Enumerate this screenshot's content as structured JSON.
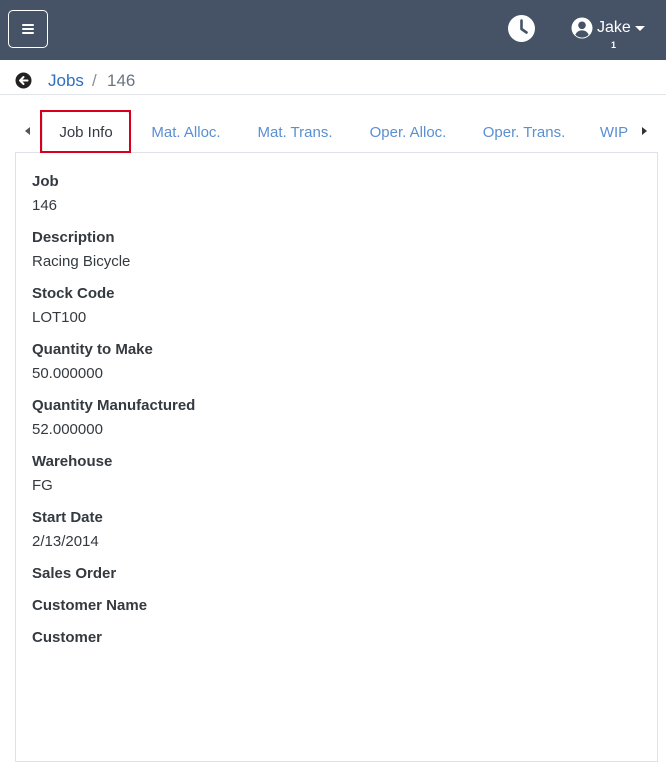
{
  "header": {
    "menu_icon": "hamburger-icon",
    "clock_icon": "clock-icon",
    "user": {
      "name": "Jake",
      "badge": "1",
      "icon": "user-circle-icon"
    },
    "bg_color": "#465366"
  },
  "breadcrumb": {
    "back_icon": "arrow-left-circle-icon",
    "parent": "Jobs",
    "separator": "/",
    "current": "146"
  },
  "tabs": [
    {
      "label": "Job Info",
      "active": true
    },
    {
      "label": "Mat. Alloc.",
      "active": false
    },
    {
      "label": "Mat. Trans.",
      "active": false
    },
    {
      "label": "Oper. Alloc.",
      "active": false
    },
    {
      "label": "Oper. Trans.",
      "active": false
    },
    {
      "label": "WIP",
      "active": false
    }
  ],
  "fields": [
    {
      "label": "Job",
      "value": "146"
    },
    {
      "label": "Description",
      "value": "Racing Bicycle"
    },
    {
      "label": "Stock Code",
      "value": "LOT100"
    },
    {
      "label": "Quantity to Make",
      "value": "50.000000"
    },
    {
      "label": "Quantity Manufactured",
      "value": "52.000000"
    },
    {
      "label": "Warehouse",
      "value": "FG"
    },
    {
      "label": "Start Date",
      "value": "2/13/2014"
    },
    {
      "label": "Sales Order",
      "value": ""
    },
    {
      "label": "Customer Name",
      "value": ""
    },
    {
      "label": "Customer",
      "value": ""
    }
  ],
  "colors": {
    "link": "#2f6fc0",
    "tab_link": "#5b8fd1",
    "highlight": "#d6001c"
  }
}
